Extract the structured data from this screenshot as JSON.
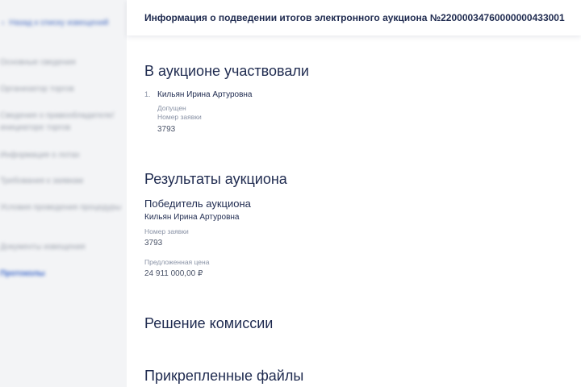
{
  "sidebar": {
    "back_label": "Назад к списку извещений",
    "items": [
      {
        "label": "Основные сведения"
      },
      {
        "label": "Организатор торгов"
      },
      {
        "label": "Сведения о правообладателе/инициаторе торгов"
      },
      {
        "label": "Информация о лотах"
      },
      {
        "label": "Требования к заявкам"
      },
      {
        "label": "Условия проведения процедуры"
      },
      {
        "label": "Документы извещения"
      },
      {
        "label": "Протоколы"
      }
    ]
  },
  "header": {
    "title": "Информация о подведении итогов электронного аукциона №22000034760000000433001"
  },
  "participants": {
    "heading": "В аукционе участвовали",
    "list": [
      {
        "index": "1.",
        "name": "Кильян Ирина Артуровна",
        "status": "Допущен",
        "bid_label": "Номер заявки",
        "bid_number": "3793"
      }
    ]
  },
  "results": {
    "heading": "Результаты аукциона",
    "winner_heading": "Победитель аукциона",
    "winner_name": "Кильян Ирина Артуровна",
    "bid_label": "Номер заявки",
    "bid_number": "3793",
    "price_label": "Предложенная цена",
    "price_value": "24 911 000,00 ₽"
  },
  "commission": {
    "heading": "Решение комиссии"
  },
  "files": {
    "heading": "Прикрепленные файлы"
  }
}
